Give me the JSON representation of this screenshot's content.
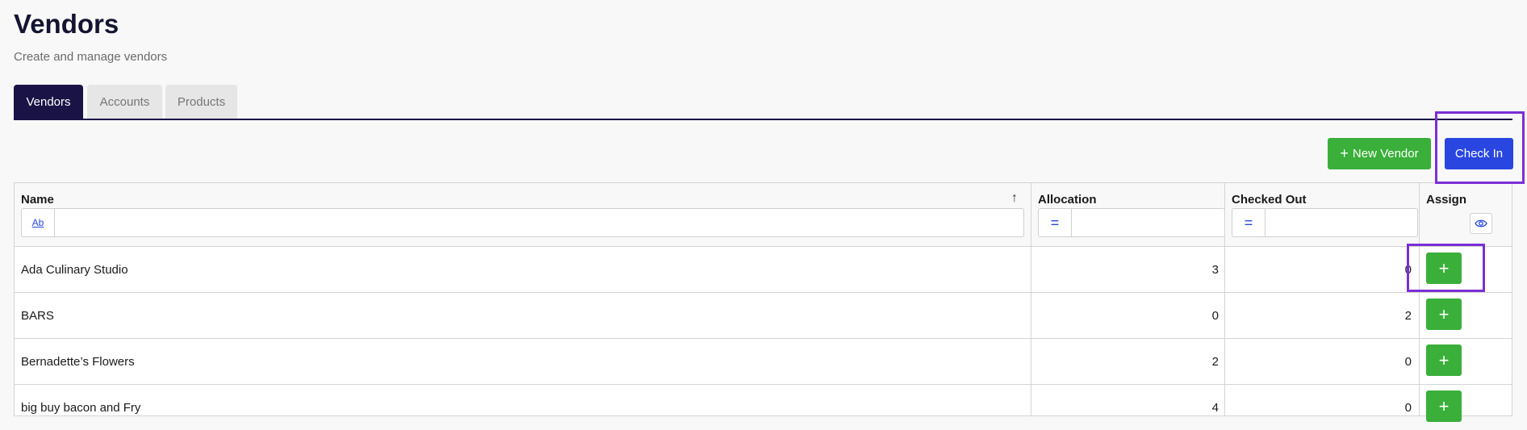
{
  "header": {
    "title": "Vendors",
    "subtitle": "Create and manage vendors"
  },
  "tabs": [
    {
      "label": "Vendors",
      "active": true
    },
    {
      "label": "Accounts",
      "active": false
    },
    {
      "label": "Products",
      "active": false
    }
  ],
  "toolbar": {
    "new_vendor_label": "New Vendor",
    "check_in_label": "Check In"
  },
  "table": {
    "columns": {
      "name": "Name",
      "allocation": "Allocation",
      "checked_out": "Checked Out",
      "assign": "Assign"
    },
    "filters": {
      "name_mode": "Ab",
      "allocation_mode": "=",
      "checked_out_mode": "="
    },
    "rows": [
      {
        "name": "Ada Culinary Studio",
        "allocation": "3",
        "checked_out": "0"
      },
      {
        "name": "BARS",
        "allocation": "0",
        "checked_out": "2"
      },
      {
        "name": "Bernadette’s Flowers",
        "allocation": "2",
        "checked_out": "0"
      },
      {
        "name": "big buy bacon and Fry",
        "allocation": "4",
        "checked_out": "0"
      }
    ],
    "assign_label": "+"
  },
  "colors": {
    "accent_dark": "#1a1446",
    "green": "#3aaf3a",
    "blue": "#2946e0",
    "highlight": "#7b2fd6"
  }
}
